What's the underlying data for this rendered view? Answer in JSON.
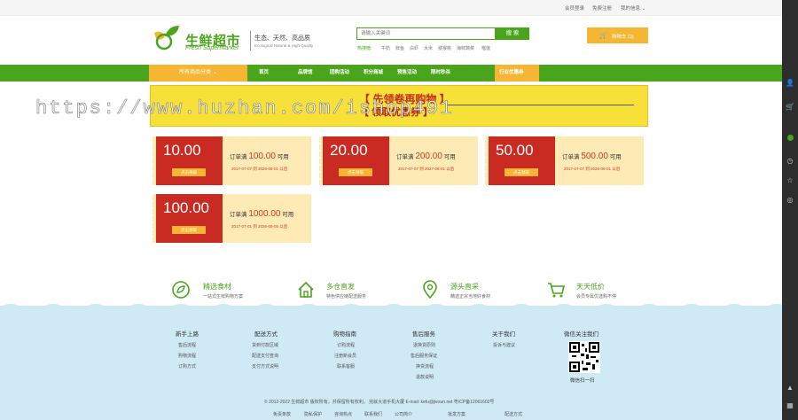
{
  "topbar": {
    "login": "会员登录",
    "register": "免费注册",
    "orders": "我的信息 ⌄"
  },
  "header": {
    "logo_cn": "生鲜超市",
    "logo_en": "Fresh Supermarket",
    "slogan_cn": "生态、天然、高品质",
    "slogan_en": "Ecological Natural & High Quality",
    "search_placeholder": "请输入关键词",
    "search_button": "搜 索",
    "hot_label": "热搜榜:",
    "hot_words": [
      "牛奶",
      "鲜鱼",
      "白虾",
      "大米",
      "猕猴桃",
      "海鲜蔬菜",
      "榴莲"
    ],
    "cart_label": "购物车 (0)"
  },
  "nav": {
    "category": "所有商品分类",
    "items": [
      "首页",
      "品牌馆",
      "团购活动",
      "积分商城",
      "预售活动",
      "限时秒杀",
      "行业优惠券"
    ]
  },
  "banner": {
    "title": "【 先领卷再购物 】",
    "subtitle": "【 领取优惠券 】",
    "watermark": "https://www.huzhan.com/ishop491"
  },
  "coupons": [
    {
      "amount": "10.00",
      "btn": "点击领取",
      "cond_pre": "订单满",
      "cond_amount": "100.00",
      "cond_post": "可用",
      "date": "2017-07-07 到 2026-08-01 以后"
    },
    {
      "amount": "20.00",
      "btn": "点击领取",
      "cond_pre": "订单满",
      "cond_amount": "200.00",
      "cond_post": "可用",
      "date": "2017-07-07 到 2027-08-01 以后"
    },
    {
      "amount": "50.00",
      "btn": "点击领取",
      "cond_pre": "订单满",
      "cond_amount": "500.00",
      "cond_post": "可用",
      "date": "2017-07-07 到 2026-08-01 以后"
    },
    {
      "amount": "100.00",
      "btn": "点击领取",
      "cond_pre": "订单满",
      "cond_amount": "1000.00",
      "cond_post": "可用",
      "date": "2017-07-01 到 2026-08-05 以后"
    }
  ],
  "features": [
    {
      "title": "精选食材",
      "desc": "一站式生鲜购物方案",
      "icon": "leaf-icon"
    },
    {
      "title": "多仓直发",
      "desc": "特色供应链配送服务",
      "icon": "house-icon"
    },
    {
      "title": "源头直采",
      "desc": "精选正宗当地好食材",
      "icon": "location-pin-icon"
    },
    {
      "title": "天天低价",
      "desc": "会员专属优选购不停",
      "icon": "cart-icon"
    }
  ],
  "footer": {
    "columns": [
      {
        "title": "新手上路",
        "links": [
          "售后流程",
          "购物流程",
          "订购方式"
        ]
      },
      {
        "title": "配送方式",
        "links": [
          "货到付款区域",
          "配送支付查询",
          "支付方式说明"
        ]
      },
      {
        "title": "购物指南",
        "links": [
          "订购流程",
          "注册新会员",
          "联系客服"
        ]
      },
      {
        "title": "售后服务",
        "links": [
          "退换货原则",
          "售后服务保证",
          "换货流程",
          "退款说明"
        ]
      },
      {
        "title": "关于我们",
        "links": [
          "投诉与建议"
        ]
      }
    ],
    "qr_title": "微信关注我们",
    "qr_caption": "微信扫一扫",
    "copyright": "© 2012-2022 生鲜超市 版权所有，并保留所有权利。 完就大道手机大厦 E-mail: kefu@jiexun.net 粤ICP备12061602号",
    "bottom_links": [
      "免责条款",
      "隐私保护",
      "咨询热点",
      "联系我们",
      "公司简介",
      "批发方案",
      "配送方式"
    ]
  },
  "colors": {
    "green": "#4aa51c",
    "orange": "#f6b633",
    "red": "#c92b23",
    "yellow": "#f7e139",
    "footer_blue": "#cfe9f5"
  },
  "sidebar": {
    "icons": [
      "user-icon",
      "cart-icon",
      "history-icon",
      "star-icon",
      "coupon-icon",
      "top-icon",
      "qrcode-icon"
    ]
  }
}
